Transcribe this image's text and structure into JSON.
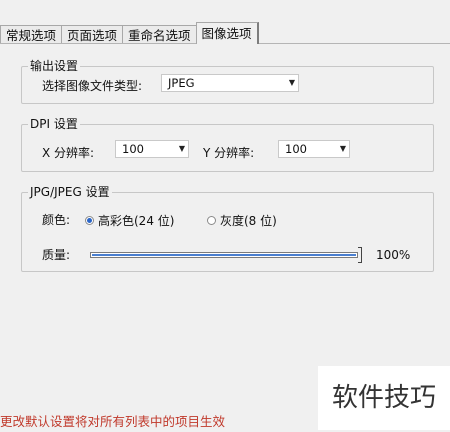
{
  "tabs": [
    "常规选项",
    "页面选项",
    "重命名选项",
    "图像选项"
  ],
  "output": {
    "legend": "输出设置",
    "file_type_label": "选择图像文件类型:",
    "file_type_value": "JPEG"
  },
  "dpi": {
    "legend": "DPI 设置",
    "x_label": "X 分辨率:",
    "x_value": "100",
    "y_label": "Y 分辨率:",
    "y_value": "100"
  },
  "jpeg": {
    "legend": "JPG/JPEG 设置",
    "color_label": "颜色:",
    "option_color": "高彩色(24 位)",
    "option_gray": "灰度(8 位)",
    "quality_label": "质量:",
    "quality_value": 1.0,
    "quality_text": "100%"
  },
  "footer_note": "更改默认设置将对所有列表中的项目生效",
  "watermark": "软件技巧",
  "colors": {
    "footer": "#c0392b",
    "slider_fill": "#4a7fd0"
  }
}
